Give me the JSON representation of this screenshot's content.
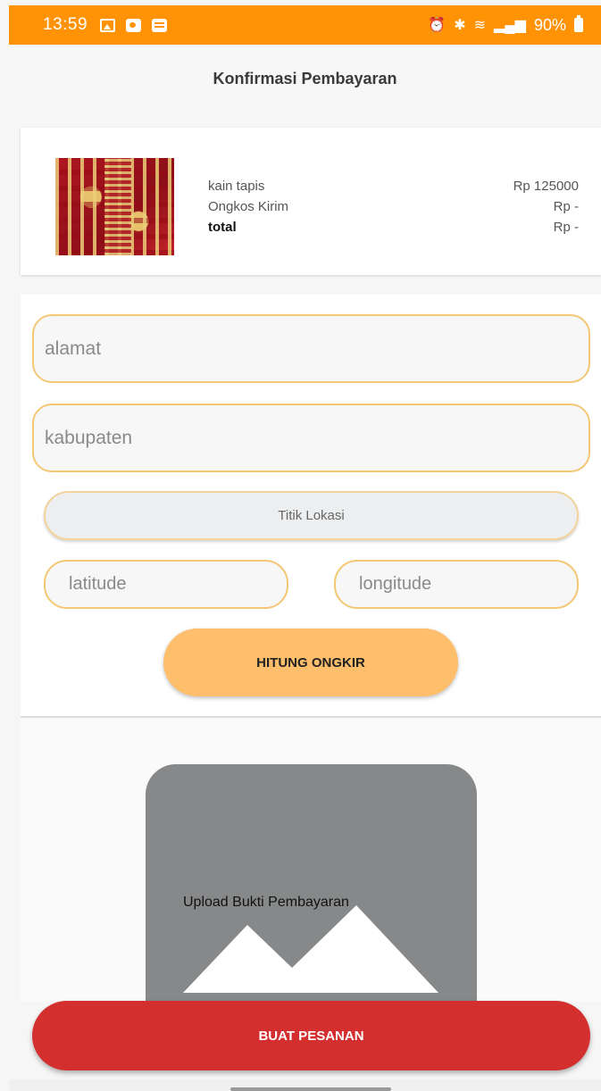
{
  "status_bar": {
    "time": "13:59",
    "battery": "90%",
    "icons_left": [
      "gallery-icon",
      "message-icon",
      "notes-icon"
    ],
    "icons_right": [
      "alarm-icon",
      "bluetooth-icon",
      "wifi-icon",
      "signal-icon",
      "battery-icon"
    ]
  },
  "header": {
    "title": "Konfirmasi Pembayaran"
  },
  "summary": {
    "rows": [
      {
        "label": "kain tapis",
        "value": "Rp 125000"
      },
      {
        "label": "Ongkos Kirim",
        "value": "Rp -"
      },
      {
        "label": "total",
        "value": "Rp -"
      }
    ]
  },
  "form": {
    "alamat_placeholder": "alamat",
    "kabupaten_placeholder": "kabupaten",
    "titik_lokasi_label": "Titik Lokasi",
    "latitude_placeholder": "latitude",
    "longitude_placeholder": "longitude",
    "hitung_ongkir_label": "HITUNG ONGKIR"
  },
  "upload": {
    "label": "Upload Bukti Pembayaran"
  },
  "footer": {
    "buat_pesanan_label": "BUAT PESANAN"
  },
  "colors": {
    "status_bar": "#ff9305",
    "field_border": "#f3c774",
    "hitung_button": "#fdbf6b",
    "pesan_button": "#d32f2f",
    "upload_box": "#878889"
  }
}
